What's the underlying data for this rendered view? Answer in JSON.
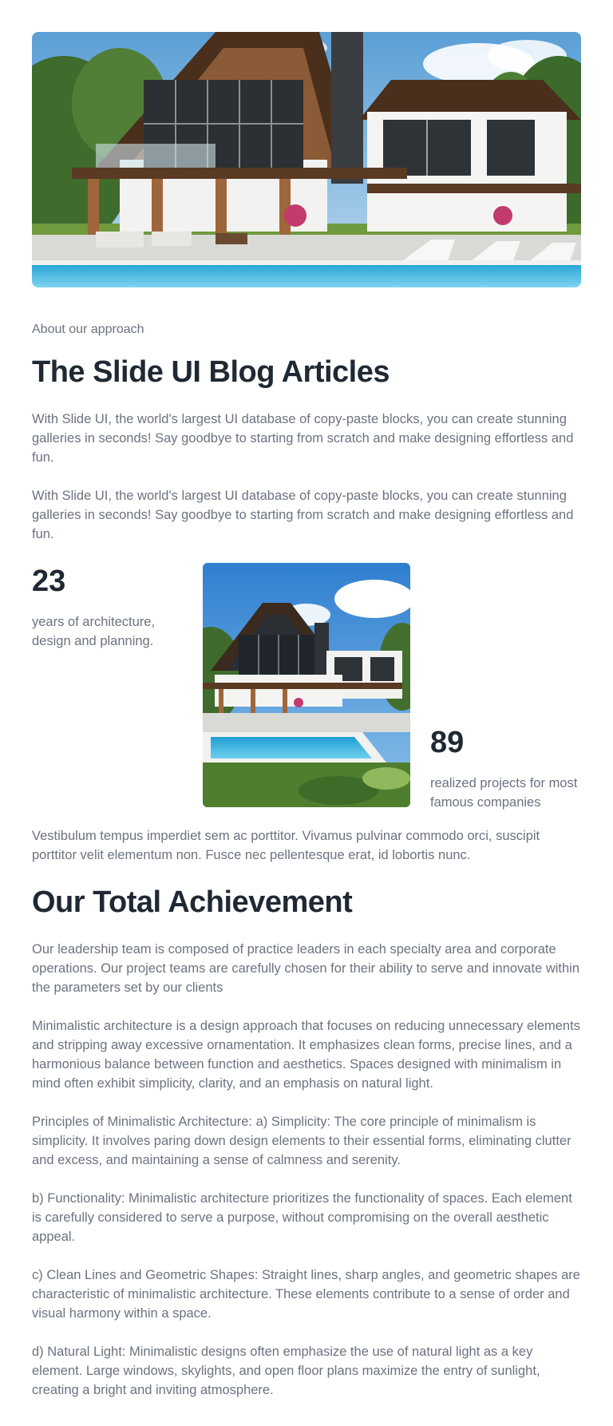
{
  "hero": {
    "image_alt": "Modern two-story house with pool"
  },
  "intro": {
    "eyebrow": "About our approach",
    "title": "The Slide UI Blog Articles",
    "paragraphs": [
      "With Slide UI, the world's largest UI database of copy-paste blocks, you can create stunning galleries in seconds! Say goodbye to starting from scratch and make designing effortless and fun.",
      "With Slide UI, the world's largest UI database of copy-paste blocks, you can create stunning galleries in seconds! Say goodbye to starting from scratch and make designing effortless and fun."
    ]
  },
  "stats": {
    "left": {
      "number": "23",
      "label": "years of architecture, design and planning."
    },
    "right": {
      "number": "89",
      "label": "realized projects for most famous companies"
    },
    "image_alt": "Modern house with pool, square view"
  },
  "vestibulum": "Vestibulum tempus imperdiet sem ac porttitor. Vivamus pulvinar commodo orci, suscipit porttitor velit elementum non. Fusce nec pellentesque erat, id lobortis nunc.",
  "achievement": {
    "title": "Our Total Achievement",
    "paragraphs": [
      "Our leadership team is composed of practice leaders in each specialty area and corporate operations. Our project teams are carefully chosen for their ability to serve and innovate within the parameters set by our clients",
      "Minimalistic architecture is a design approach that focuses on reducing unnecessary elements and stripping away excessive ornamentation. It emphasizes clean forms, precise lines, and a harmonious balance between function and aesthetics. Spaces designed with minimalism in mind often exhibit simplicity, clarity, and an emphasis on natural light.",
      "Principles of Minimalistic Architecture: a) Simplicity: The core principle of minimalism is simplicity. It involves paring down design elements to their essential forms, eliminating clutter and excess, and maintaining a sense of calmness and serenity.",
      "b) Functionality: Minimalistic architecture prioritizes the functionality of spaces. Each element is carefully considered to serve a purpose, without compromising on the overall aesthetic appeal.",
      "c) Clean Lines and Geometric Shapes: Straight lines, sharp angles, and geometric shapes are characteristic of minimalistic architecture. These elements contribute to a sense of order and visual harmony within a space.",
      "d) Natural Light: Minimalistic designs often emphasize the use of natural light as a key element. Large windows, skylights, and open floor plans maximize the entry of sunlight, creating a bright and inviting atmosphere."
    ]
  }
}
